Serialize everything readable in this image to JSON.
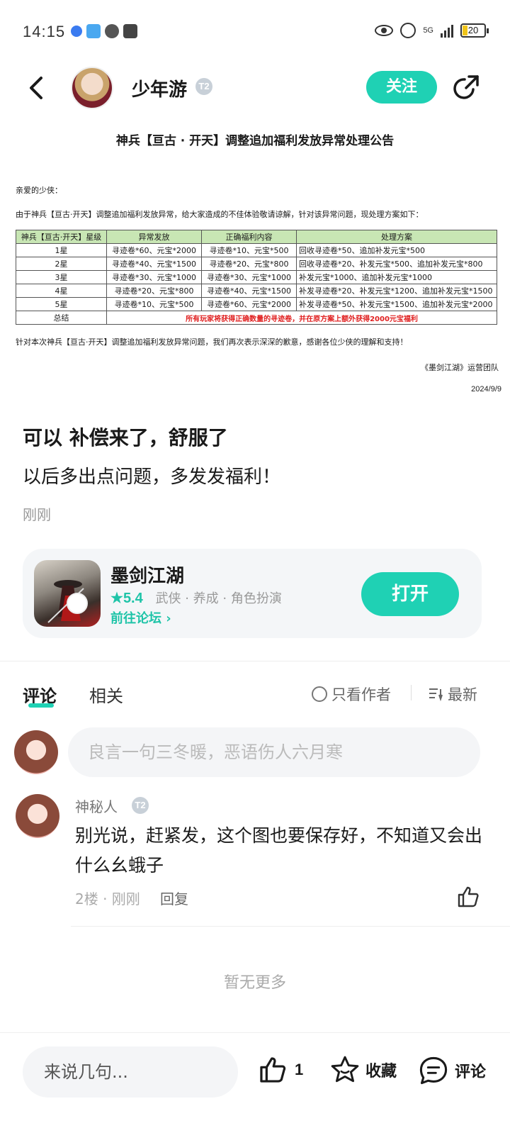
{
  "status_bar": {
    "time": "14:15",
    "network": "5G",
    "battery": "20"
  },
  "header": {
    "author_name": "少年游",
    "author_level": "T2",
    "follow_label": "关注"
  },
  "notice": {
    "title": "神兵【亘古 · 开天】调整追加福利发放异常处理公告",
    "greeting": "亲爱的少侠：",
    "intro": "由于神兵【亘古·开天】调整追加福利发放异常，给大家造成的不佳体验敬请谅解，针对该异常问题，现处理方案如下：",
    "table": {
      "headers": [
        "神兵【亘古·开天】星级",
        "异常发放",
        "正确福利内容",
        "处理方案"
      ],
      "rows": [
        [
          "1星",
          "寻迹卷*60、元宝*2000",
          "寻迹卷*10、元宝*500",
          "回收寻迹卷*50、追加补发元宝*500"
        ],
        [
          "2星",
          "寻迹卷*40、元宝*1500",
          "寻迹卷*20、元宝*800",
          "回收寻迹卷*20、补发元宝*500、追加补发元宝*800"
        ],
        [
          "3星",
          "寻迹卷*30、元宝*1000",
          "寻迹卷*30、元宝*1000",
          "补发元宝*1000、追加补发元宝*1000"
        ],
        [
          "4星",
          "寻迹卷*20、元宝*800",
          "寻迹卷*40、元宝*1500",
          "补发寻迹卷*20、补发元宝*1200、追加补发元宝*1500"
        ],
        [
          "5星",
          "寻迹卷*10、元宝*500",
          "寻迹卷*60、元宝*2000",
          "补发寻迹卷*50、补发元宝*1500、追加补发元宝*2000"
        ]
      ],
      "summary_label": "总结",
      "summary_text": "所有玩家将获得正确数量的寻迹卷，并在原方案上额外获得2000元宝福利"
    },
    "closing": "针对本次神兵【亘古·开天】调整追加福利发放异常问题，我们再次表示深深的歉意，感谢各位少侠的理解和支持！",
    "team": "《墨剑江湖》运营团队",
    "date": "2024/9/9"
  },
  "post": {
    "title": "可以 补偿来了，舒服了",
    "body": "以后多出点问题，多发发福利！",
    "time": "刚刚"
  },
  "game_card": {
    "name": "墨剑江湖",
    "rating": "5.4",
    "tags": "武侠 · 养成 · 角色扮演",
    "forum_link": "前往论坛",
    "open_label": "打开"
  },
  "tabs": {
    "comments": "评论",
    "related": "相关",
    "only_author": "只看作者",
    "sort": "最新"
  },
  "comment_input": {
    "placeholder": "良言一句三冬暖，恶语伤人六月寒"
  },
  "comments": [
    {
      "name": "神秘人",
      "level": "T2",
      "text": "别光说，赶紧发，这个图也要保存好，不知道又会出什么幺蛾子",
      "meta": "2楼 · 刚刚",
      "reply": "回复"
    }
  ],
  "no_more": "暂无更多",
  "bottom_bar": {
    "input_placeholder": "来说几句...",
    "like_count": "1",
    "favorite_label": "收藏",
    "comment_label": "评论"
  },
  "colors": {
    "accent": "#1fd1b4",
    "notice_red": "#e02020",
    "table_header": "#c8e6b4"
  }
}
